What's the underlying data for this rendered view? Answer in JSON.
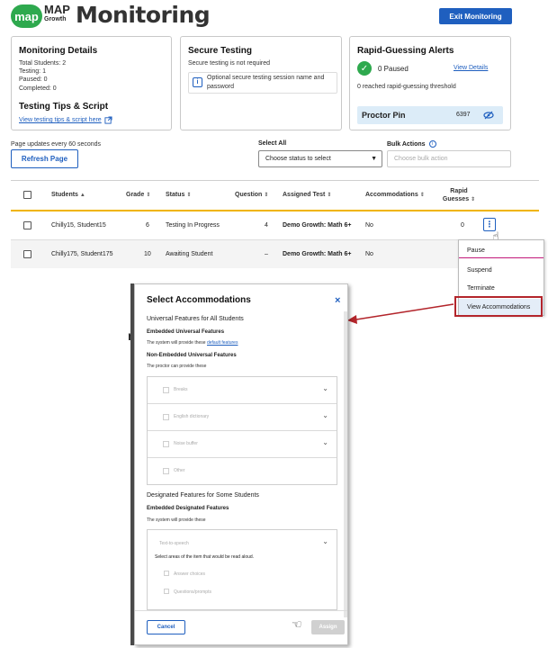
{
  "header": {
    "logo_mark": "map",
    "logo_map": "MAP",
    "logo_growth": "Growth",
    "title": "Monitoring",
    "exit_button": "Exit Monitoring"
  },
  "monitoring_details": {
    "title": "Monitoring Details",
    "total_students": "Total Students: 2",
    "testing": "Testing: 1",
    "paused": "Paused: 0",
    "completed": "Completed: 0",
    "tips_title": "Testing Tips & Script",
    "tips_link": "View testing tips & script here"
  },
  "secure_testing": {
    "title": "Secure Testing",
    "status": "Secure testing is not required",
    "info_text": "Optional secure testing session name and password"
  },
  "rapid_guessing": {
    "title": "Rapid-Guessing Alerts",
    "paused_text": "0 Paused",
    "view_details": "View Details",
    "threshold_text": "0 reached rapid-guessing threshold",
    "proctor_pin_label": "Proctor Pin",
    "proctor_pin_value": "6397"
  },
  "controls": {
    "update_text": "Page updates every 60 seconds",
    "refresh_button": "Refresh Page",
    "select_all_label": "Select All",
    "status_select_placeholder": "Choose status to select",
    "bulk_actions_label": "Bulk Actions",
    "bulk_action_placeholder": "Choose bulk action"
  },
  "table": {
    "columns": [
      "Students",
      "Grade",
      "Status",
      "Question",
      "Assigned Test",
      "Accommodations",
      "Rapid Guesses"
    ],
    "rows": [
      {
        "student": "Chilly15, Student15",
        "grade": "6",
        "status": "Testing In Progress",
        "question": "4",
        "test": "Demo Growth: Math 6+",
        "accommodations": "No",
        "rapid": "0"
      },
      {
        "student": "Chilly175, Student175",
        "grade": "10",
        "status": "Awaiting Student",
        "question": "–",
        "test": "Demo Growth: Math 6+",
        "accommodations": "No",
        "rapid": ""
      }
    ]
  },
  "row_menu": {
    "items": [
      "Pause",
      "Suspend",
      "Terminate",
      "View Accommodations"
    ]
  },
  "background_fragment": "n",
  "modal": {
    "title": "Select Accommodations",
    "universal_title": "Universal Features for All Students",
    "embedded_universal": "Embedded Universal Features",
    "embedded_universal_desc": "The system will provide these",
    "default_features_link": "default features",
    "non_embedded_universal": "Non-Embedded Universal Features",
    "non_embedded_desc": "The proctor can provide these",
    "features": [
      "Breaks",
      "English dictionary",
      "Noise buffer",
      "Other"
    ],
    "designated_title": "Designated Features for Some Students",
    "embedded_designated": "Embedded Designated Features",
    "embedded_designated_desc": "The system will provide these",
    "tts_label": "Text-to-speech",
    "tts_instruction": "Select areas of the item that would be read aloud.",
    "tts_options": [
      "Answer choices",
      "Questions/prompts"
    ],
    "cancel_button": "Cancel",
    "assign_button": "Assign"
  },
  "colors": {
    "brand_green": "#2ea94e",
    "primary_blue": "#1f5fbf",
    "highlight_red": "#b3252b",
    "menu_accent": "#c2187a",
    "table_accent": "#f0b400"
  }
}
